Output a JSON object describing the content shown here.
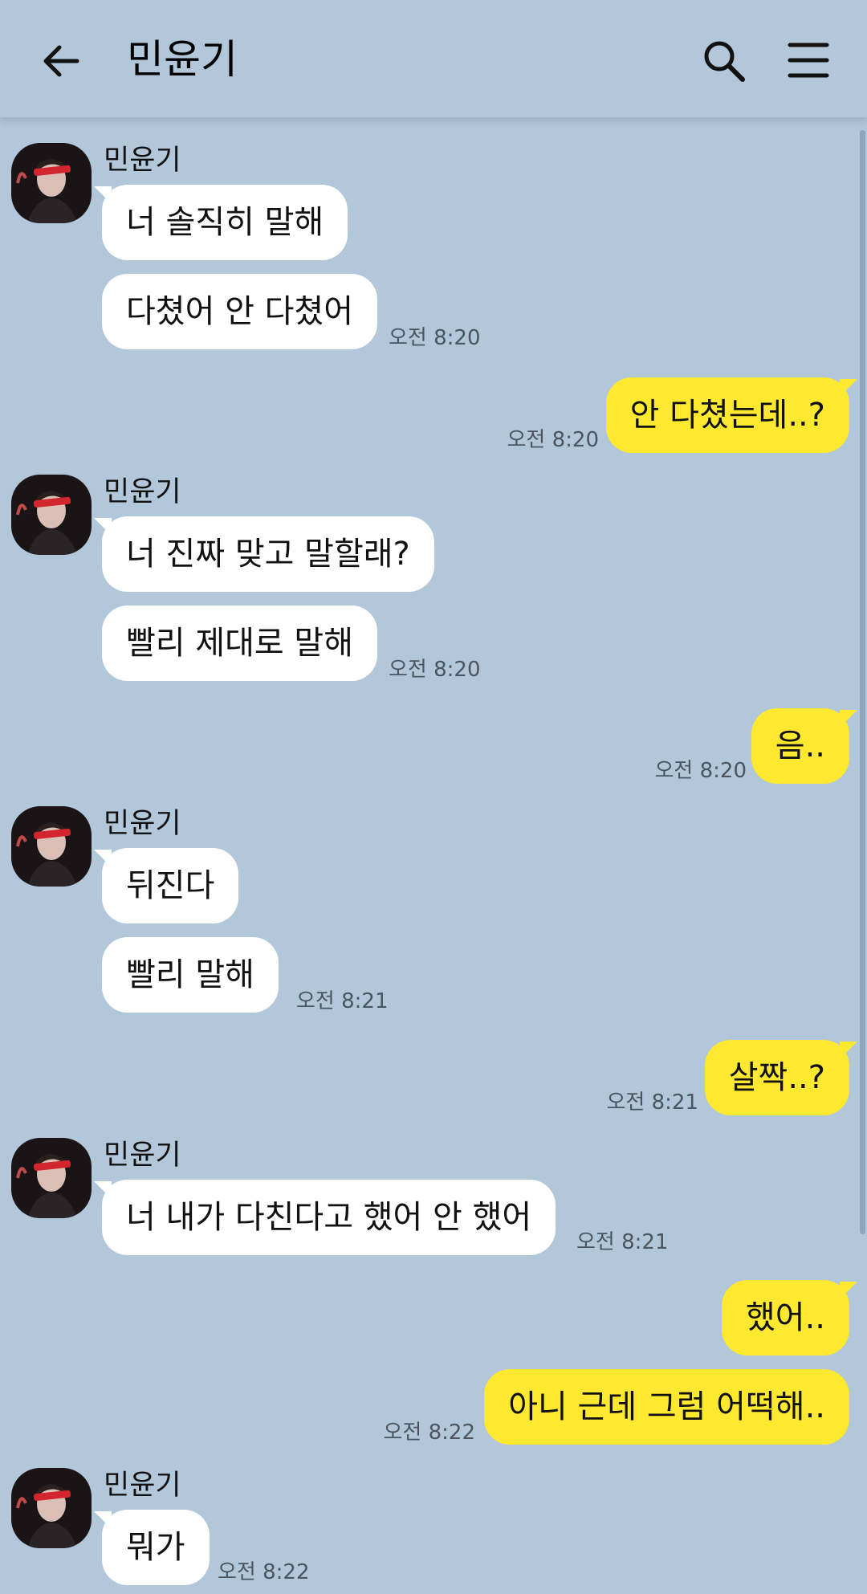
{
  "header": {
    "title": "민윤기"
  },
  "icons": {
    "back": "arrow-left-icon",
    "search": "search-icon",
    "menu": "hamburger-menu-icon"
  },
  "colors": {
    "background": "#b2c7d9",
    "incoming_bubble": "#ffffff",
    "outgoing_bubble": "#fee830"
  },
  "messages": {
    "g1": {
      "sender": "민윤기",
      "m1": "너 솔직히 말해",
      "m2": "다쳤어 안 다쳤어",
      "time": "오전 8:20"
    },
    "o1": {
      "m1": "안 다쳤는데..?",
      "time": "오전 8:20"
    },
    "g2": {
      "sender": "민윤기",
      "m1": "너 진짜 맞고 말할래?",
      "m2": "빨리 제대로 말해",
      "time": "오전 8:20"
    },
    "o2": {
      "m1": "음..",
      "time": "오전 8:20"
    },
    "g3": {
      "sender": "민윤기",
      "m1": "뒤진다",
      "m2": "빨리 말해",
      "time": "오전 8:21"
    },
    "o3": {
      "m1": "살짝..?",
      "time": "오전 8:21"
    },
    "g4": {
      "sender": "민윤기",
      "m1": "너 내가 다친다고 했어 안 했어",
      "time": "오전 8:21"
    },
    "o4": {
      "m1": "했어..",
      "m2": "아니 근데 그럼 어떡해..",
      "time": "오전 8:22"
    },
    "g5": {
      "sender": "민윤기",
      "m1": "뭐가",
      "time": "오전 8:22"
    }
  }
}
